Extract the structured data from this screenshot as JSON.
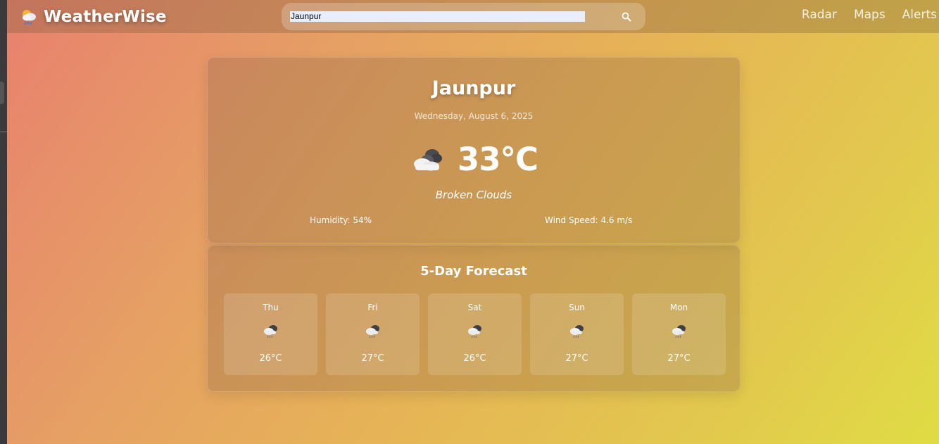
{
  "app": {
    "name": "WeatherWise",
    "logo_icon": "weather-logo-icon"
  },
  "search": {
    "value": "Jaunpur",
    "placeholder": "",
    "icon": "search-icon"
  },
  "nav": {
    "links": [
      {
        "label": "Radar"
      },
      {
        "label": "Maps"
      },
      {
        "label": "Alerts"
      }
    ]
  },
  "current": {
    "city": "Jaunpur",
    "date": "Wednesday, August 6, 2025",
    "temperature": "33°C",
    "condition": "Broken Clouds",
    "icon": "broken-clouds-icon",
    "humidity": "Humidity: 54%",
    "wind": "Wind Speed: 4.6 m/s"
  },
  "forecast": {
    "title": "5-Day Forecast",
    "days": [
      {
        "day": "Thu",
        "temp": "26°C",
        "icon": "rain-cloud-icon"
      },
      {
        "day": "Fri",
        "temp": "27°C",
        "icon": "rain-cloud-icon"
      },
      {
        "day": "Sat",
        "temp": "26°C",
        "icon": "rain-cloud-icon"
      },
      {
        "day": "Sun",
        "temp": "27°C",
        "icon": "rain-cloud-icon"
      },
      {
        "day": "Mon",
        "temp": "27°C",
        "icon": "rain-cloud-icon"
      }
    ]
  },
  "colors": {
    "gradient_start": "#e8806e",
    "gradient_end": "#e0dc44",
    "text": "#ffffff"
  }
}
